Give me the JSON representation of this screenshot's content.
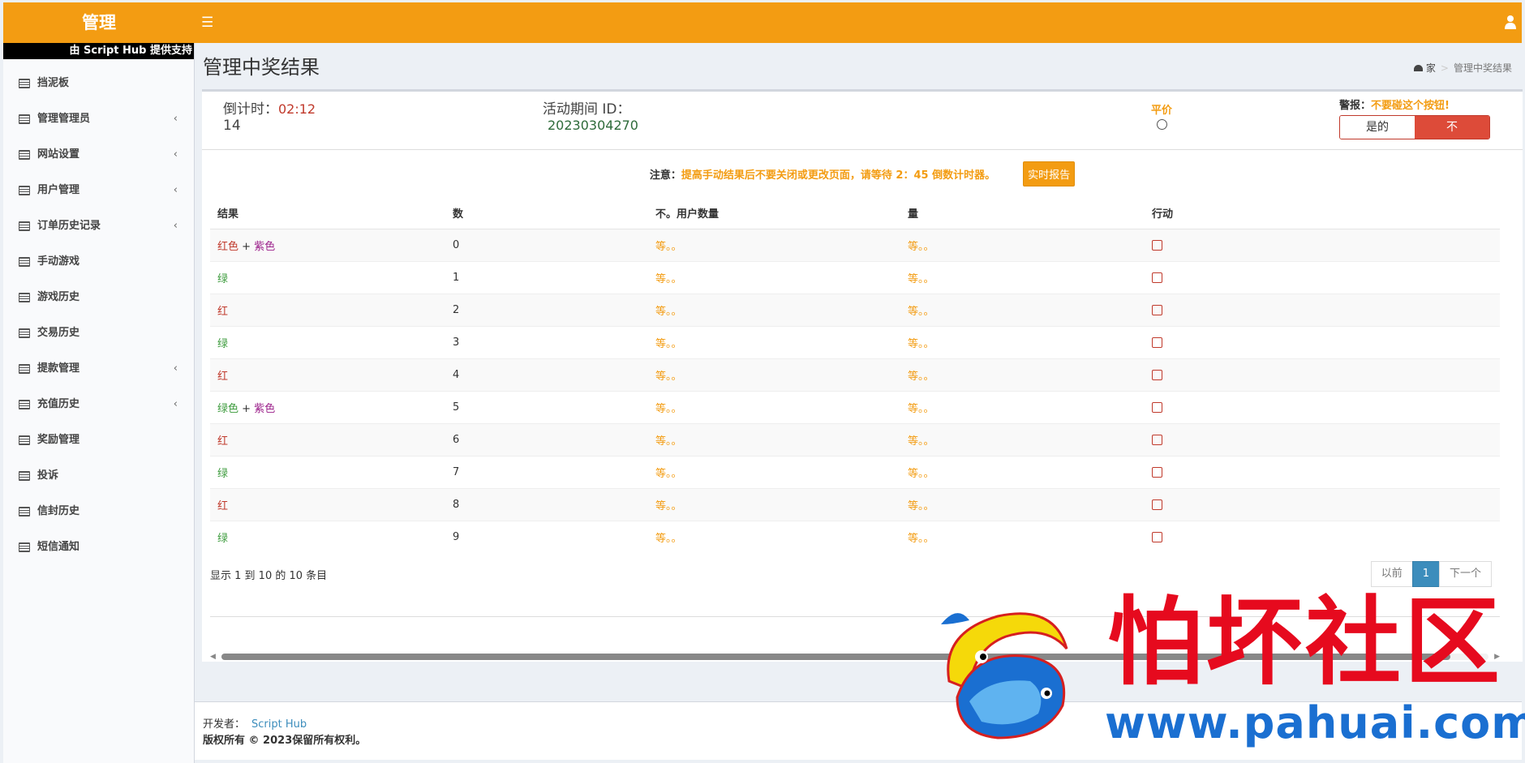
{
  "header": {
    "logo": "管理",
    "menu_icon": "bars-icon",
    "user_icon": "user-icon"
  },
  "sidebar": {
    "powered_by": "由 Script Hub 提供支持",
    "items": [
      {
        "label": "挡泥板",
        "has_sub": false
      },
      {
        "label": "管理管理员",
        "has_sub": true
      },
      {
        "label": "网站设置",
        "has_sub": true
      },
      {
        "label": "用户管理",
        "has_sub": true
      },
      {
        "label": "订单历史记录",
        "has_sub": true
      },
      {
        "label": "手动游戏",
        "has_sub": false
      },
      {
        "label": "游戏历史",
        "has_sub": false
      },
      {
        "label": "交易历史",
        "has_sub": false
      },
      {
        "label": "提款管理",
        "has_sub": true
      },
      {
        "label": "充值历史",
        "has_sub": true
      },
      {
        "label": "奖励管理",
        "has_sub": false
      },
      {
        "label": "投诉",
        "has_sub": false
      },
      {
        "label": "信封历史",
        "has_sub": false
      },
      {
        "label": "短信通知",
        "has_sub": false
      }
    ]
  },
  "page": {
    "title": "管理中奖结果",
    "breadcrumb_home": "家",
    "breadcrumb_current": "管理中奖结果"
  },
  "stats": {
    "countdown_label": "倒计时：",
    "countdown_value": "02:12",
    "countdown_extra": "14",
    "period_label": "活动期间 ID：",
    "period_value": "20230304270",
    "tie_label": "平价",
    "warning_label": "警报：",
    "warning_text": "不要碰这个按钮!",
    "yes_label": "是的",
    "no_label": "不"
  },
  "notice": {
    "label": "注意：",
    "text": "提高手动结果后不要关闭或更改页面，请等待 2：45 倒数计时器。",
    "report_button": "实时报告"
  },
  "table": {
    "headers": [
      "结果",
      "数",
      "不。用户数量",
      "量",
      "行动"
    ],
    "rows": [
      {
        "result": [
          {
            "t": "红色",
            "c": "red"
          },
          {
            "t": " + ",
            "c": ""
          },
          {
            "t": "紫色",
            "c": "purple"
          }
        ],
        "num": "0",
        "users": "等。。",
        "amount": "等。。"
      },
      {
        "result": [
          {
            "t": "绿",
            "c": "green"
          }
        ],
        "num": "1",
        "users": "等。。",
        "amount": "等。。"
      },
      {
        "result": [
          {
            "t": "红",
            "c": "red"
          }
        ],
        "num": "2",
        "users": "等。。",
        "amount": "等。。"
      },
      {
        "result": [
          {
            "t": "绿",
            "c": "green"
          }
        ],
        "num": "3",
        "users": "等。。",
        "amount": "等。。"
      },
      {
        "result": [
          {
            "t": "红",
            "c": "red"
          }
        ],
        "num": "4",
        "users": "等。。",
        "amount": "等。。"
      },
      {
        "result": [
          {
            "t": "绿色",
            "c": "green"
          },
          {
            "t": " + ",
            "c": ""
          },
          {
            "t": "紫色",
            "c": "purple"
          }
        ],
        "num": "5",
        "users": "等。。",
        "amount": "等。。"
      },
      {
        "result": [
          {
            "t": "红",
            "c": "red"
          }
        ],
        "num": "6",
        "users": "等。。",
        "amount": "等。。"
      },
      {
        "result": [
          {
            "t": "绿",
            "c": "green"
          }
        ],
        "num": "7",
        "users": "等。。",
        "amount": "等。。"
      },
      {
        "result": [
          {
            "t": "红",
            "c": "red"
          }
        ],
        "num": "8",
        "users": "等。。",
        "amount": "等。。"
      },
      {
        "result": [
          {
            "t": "绿",
            "c": "green"
          }
        ],
        "num": "9",
        "users": "等。。",
        "amount": "等。。"
      }
    ],
    "info": "显示 1 到 10 的 10 条目",
    "pagination": {
      "prev": "以前",
      "current": "1",
      "next": "下一个"
    }
  },
  "footer": {
    "dev_label": "开发者：",
    "dev_link": "Script Hub",
    "copyright": "版权所有 © 2023保留所有权利。"
  },
  "watermark": {
    "text": "怕坏社区",
    "url": "www.pahuai.com"
  },
  "colors": {
    "accent": "#f39c12",
    "danger": "#dd4b39",
    "primary": "#3c8dbc"
  }
}
